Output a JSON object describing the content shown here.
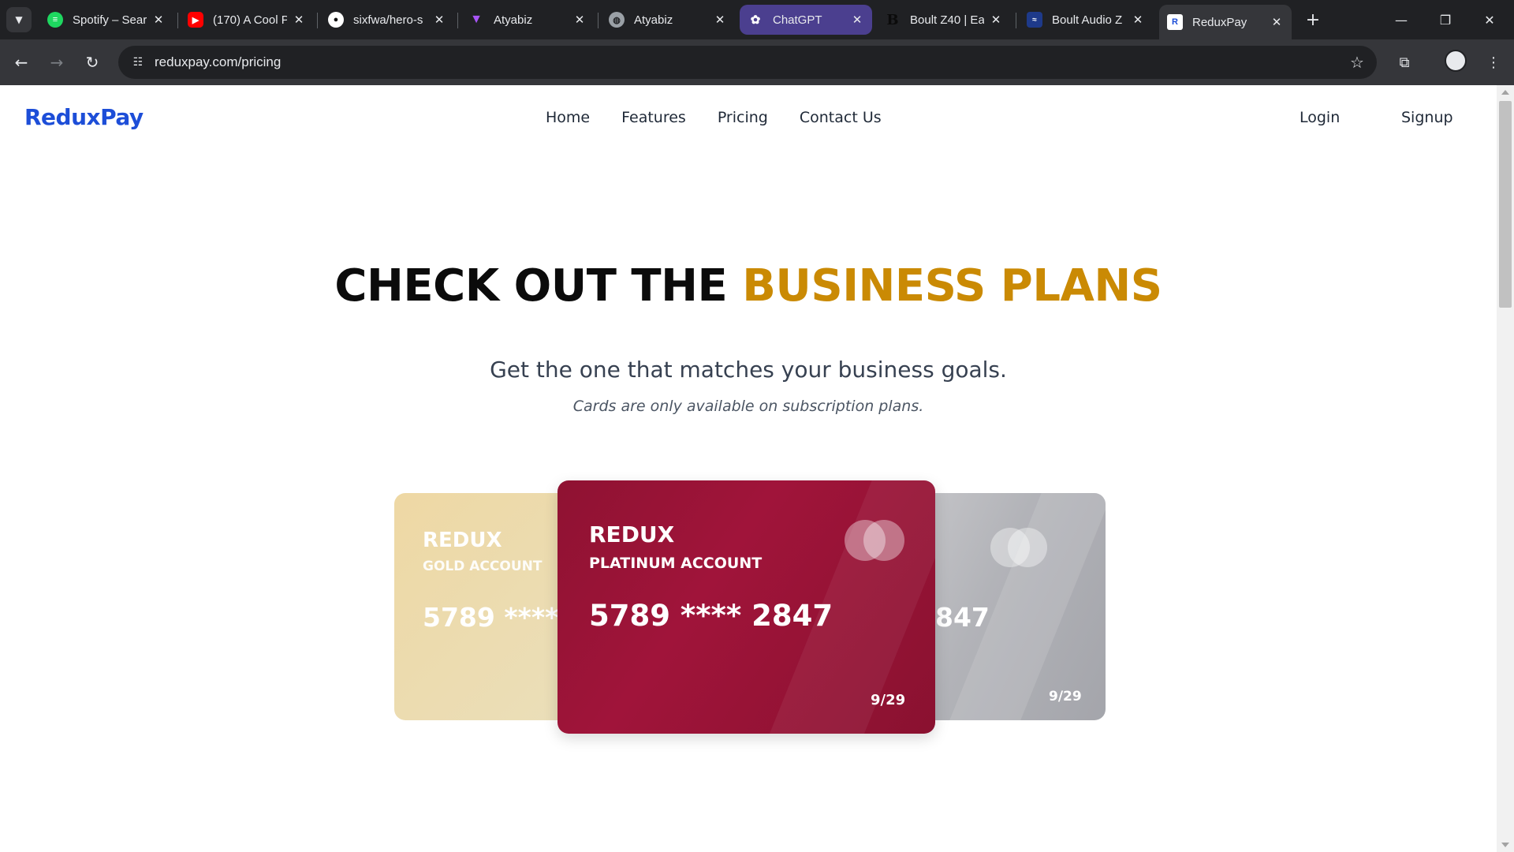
{
  "browser": {
    "tabs": [
      {
        "title": "Spotify – Sear",
        "favicon": "spotify-icon",
        "color": "#1ed760"
      },
      {
        "title": "(170) A Cool P",
        "favicon": "youtube-icon",
        "color": "#ff0000"
      },
      {
        "title": "sixfwa/hero-s",
        "favicon": "github-icon",
        "color": "#ffffff"
      },
      {
        "title": "Atyabiz",
        "favicon": "vite-icon",
        "color": "#a855f7"
      },
      {
        "title": "Atyabiz",
        "favicon": "globe-icon",
        "color": "#9aa0a6"
      },
      {
        "title": "ChatGPT",
        "favicon": "openai-icon",
        "color": "#ffffff"
      },
      {
        "title": "Boult Z40 | Ea",
        "favicon": "boult-b-icon",
        "color": "#111111"
      },
      {
        "title": "Boult Audio Z",
        "favicon": "boult-audio-icon",
        "color": "#1e3a8a"
      },
      {
        "title": "ReduxPay",
        "favicon": "reduxpay-r-icon",
        "color": "#1d4ed8"
      }
    ],
    "url": "reduxpay.com/pricing"
  },
  "site": {
    "brand": "ReduxPay",
    "nav": [
      "Home",
      "Features",
      "Pricing",
      "Contact Us"
    ],
    "login": "Login",
    "signup": "Signup"
  },
  "hero": {
    "title_plain": "CHECK OUT THE",
    "title_accent": "BUSINESS PLANS",
    "subtitle": "Get the one that matches your business goals.",
    "note": "Cards are only available on subscription plans."
  },
  "cards": {
    "gold": {
      "brand": "REDUX",
      "type": "GOLD ACCOUNT",
      "number": "5789 **** 2847",
      "color": "#ecd8a6"
    },
    "platinum": {
      "brand": "REDUX",
      "type": "PLATINUM ACCOUNT",
      "number": "5789 **** 2847",
      "expiry": "9/29",
      "color": "#9a1335"
    },
    "silver": {
      "number_visible": "847",
      "expiry": "9/29",
      "color": "#b4b5ba"
    }
  },
  "colors": {
    "brand_blue": "#1d4ed8",
    "accent_gold": "#ca8a04"
  }
}
